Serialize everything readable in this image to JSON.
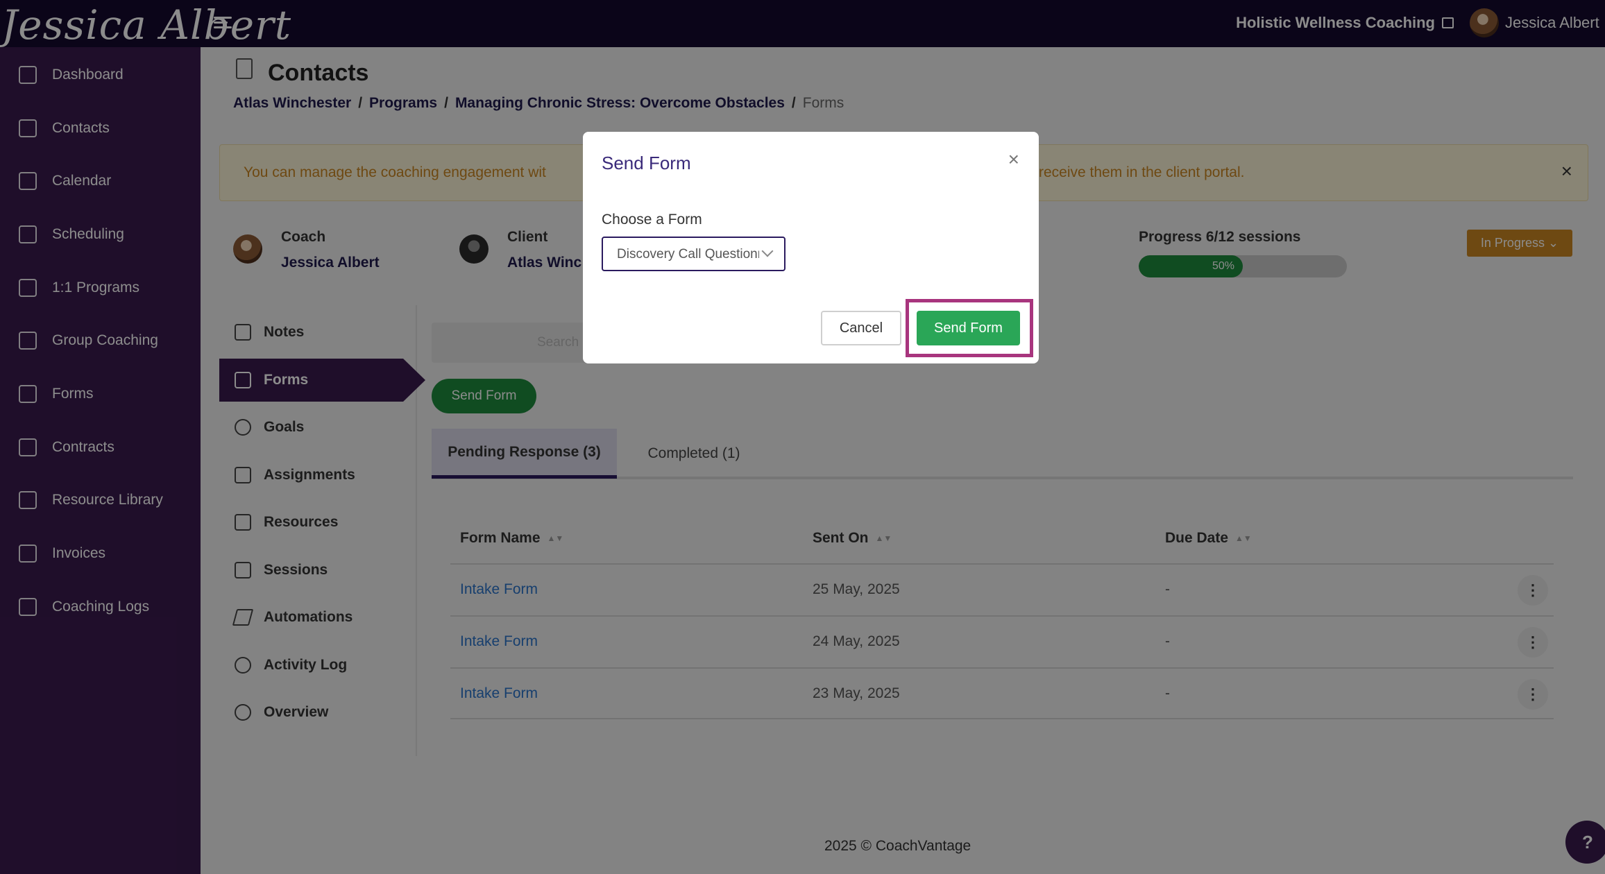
{
  "header": {
    "logo_text": "Jessica Albert",
    "business_name": "Holistic Wellness Coaching",
    "user_name": "Jessica Albert"
  },
  "sidebar": {
    "items": [
      {
        "label": "Dashboard",
        "icon": "dashboard-icon"
      },
      {
        "label": "Contacts",
        "icon": "contacts-icon"
      },
      {
        "label": "Calendar",
        "icon": "calendar-icon"
      },
      {
        "label": "Scheduling",
        "icon": "scheduling-icon"
      },
      {
        "label": "1:1 Programs",
        "icon": "book-icon"
      },
      {
        "label": "Group Coaching",
        "icon": "group-icon"
      },
      {
        "label": "Forms",
        "icon": "list-icon"
      },
      {
        "label": "Contracts",
        "icon": "signature-icon"
      },
      {
        "label": "Resource Library",
        "icon": "library-icon"
      },
      {
        "label": "Invoices",
        "icon": "invoice-icon"
      },
      {
        "label": "Coaching Logs",
        "icon": "clock-icon"
      }
    ]
  },
  "page": {
    "title": "Contacts",
    "breadcrumb": [
      "Atlas Winchester",
      "Programs",
      "Managing Chronic Stress: Overcome Obstacles",
      "Forms"
    ],
    "breadcrumb_sep": "/"
  },
  "alert": {
    "text_left": "You can manage the coaching engagement wit",
    "text_right": "receive them in the client portal.",
    "close": "×"
  },
  "engagement": {
    "coach_label": "Coach",
    "coach_name": "Jessica Albert",
    "client_label": "Client",
    "client_name": "Atlas Winc",
    "progress_label": "Progress 6/12 sessions",
    "progress_percent": 50,
    "progress_text": "50%",
    "status": "In Progress",
    "status_chevron": "⌄"
  },
  "subnav": {
    "items": [
      {
        "label": "Notes",
        "icon": "notes-icon"
      },
      {
        "label": "Forms",
        "icon": "forms-icon",
        "active": true
      },
      {
        "label": "Goals",
        "icon": "target-icon"
      },
      {
        "label": "Assignments",
        "icon": "clipboard-icon"
      },
      {
        "label": "Resources",
        "icon": "resources-icon"
      },
      {
        "label": "Sessions",
        "icon": "calendar-icon"
      },
      {
        "label": "Automations",
        "icon": "lightning-icon"
      },
      {
        "label": "Activity Log",
        "icon": "history-icon"
      },
      {
        "label": "Overview",
        "icon": "info-icon"
      }
    ]
  },
  "forms_panel": {
    "search_placeholder": "Search",
    "send_button": "Send Form",
    "tabs": [
      {
        "label": "Pending Response (3)",
        "active": true
      },
      {
        "label": "Completed (1)",
        "active": false
      }
    ],
    "columns": [
      "Form Name",
      "Sent On",
      "Due Date"
    ],
    "sort_glyph": "▲▼",
    "rows": [
      {
        "name": "Intake Form",
        "sent_on": "25 May, 2025",
        "due": "-"
      },
      {
        "name": "Intake Form",
        "sent_on": "24 May, 2025",
        "due": "-"
      },
      {
        "name": "Intake Form",
        "sent_on": "23 May, 2025",
        "due": "-"
      }
    ],
    "row_menu": "⋮"
  },
  "footer": {
    "text": "2025 © CoachVantage"
  },
  "help": {
    "label": "?"
  },
  "modal": {
    "title": "Send Form",
    "close": "×",
    "choose_label": "Choose a Form",
    "selected_form": "Discovery Call Questionnaire",
    "cancel_label": "Cancel",
    "send_label": "Send Form",
    "highlight_color": "#a8357e"
  },
  "colors": {
    "topbar": "#140a2e",
    "sidebar": "#3a1a4e",
    "send_green": "#1e8a3c",
    "status_orange": "#c98522",
    "link_blue": "#2b73c9"
  }
}
